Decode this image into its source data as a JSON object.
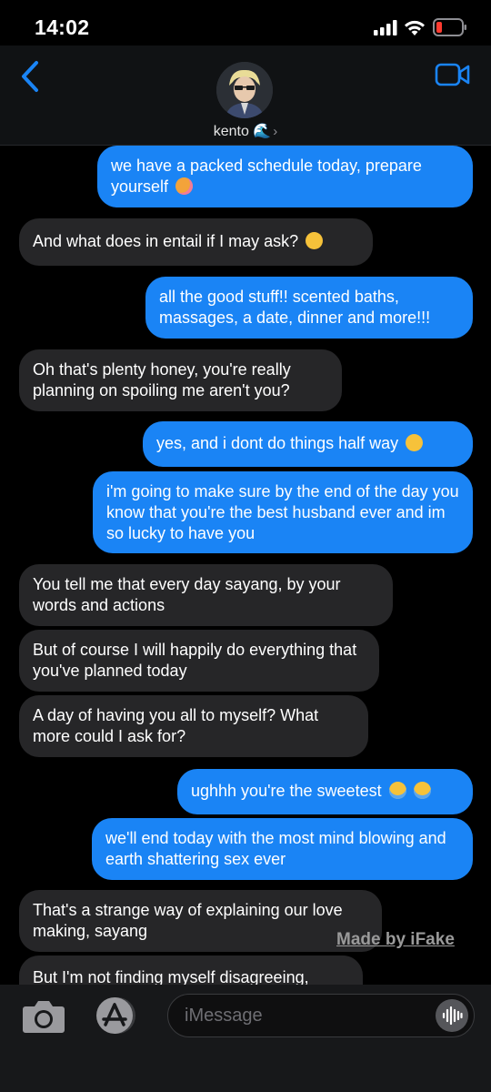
{
  "status_bar": {
    "time": "14:02",
    "battery_color": "#ff3b30"
  },
  "header": {
    "contact_name": "kento 🌊",
    "chevron": "›",
    "back_icon": "chevron-left-icon",
    "video_icon": "video-camera-icon",
    "accent_color": "#1a84f5"
  },
  "messages": [
    {
      "type": "sent",
      "text": "we have a packed schedule today, prepare yourself",
      "emoji": "smiling-face-with-hearts"
    },
    {
      "type": "received",
      "text": "And what does in entail if I may ask?",
      "emoji": "face-with-tears-of-joy"
    },
    {
      "type": "sent",
      "text": "all the good stuff!! scented baths, massages, a date, dinner and more!!!"
    },
    {
      "type": "received",
      "text": "Oh that's plenty honey, you're really planning on spoiling me aren't you?"
    },
    {
      "type": "sent",
      "text": "yes, and i dont do things half way",
      "emoji": "smirking-face"
    },
    {
      "type": "sent",
      "text": "i'm going to make sure by the end of the day you know that you're the best husband ever and im so lucky to have you"
    },
    {
      "type": "received",
      "text": "You tell me that every day sayang, by your words and actions"
    },
    {
      "type": "received",
      "text": "But of course I will happily do everything that you've planned today"
    },
    {
      "type": "received",
      "text": "A day of having you all to myself? What more could I ask for?"
    },
    {
      "type": "sent",
      "text": "ughhh you're the sweetest",
      "emoji": "loudly-crying-face x2"
    },
    {
      "type": "sent",
      "text": "we'll end today with the most mind blowing and earth shattering sex ever"
    },
    {
      "type": "received",
      "text": "That's a strange way of explaining our love making, sayang"
    },
    {
      "type": "received",
      "text": "But I'm not finding myself disagreeing,"
    }
  ],
  "watermark": "Made by iFake",
  "input_bar": {
    "placeholder": "iMessage",
    "camera_icon": "camera-icon",
    "apps_icon": "app-store-icon",
    "audio_icon": "audio-waveform-icon"
  }
}
